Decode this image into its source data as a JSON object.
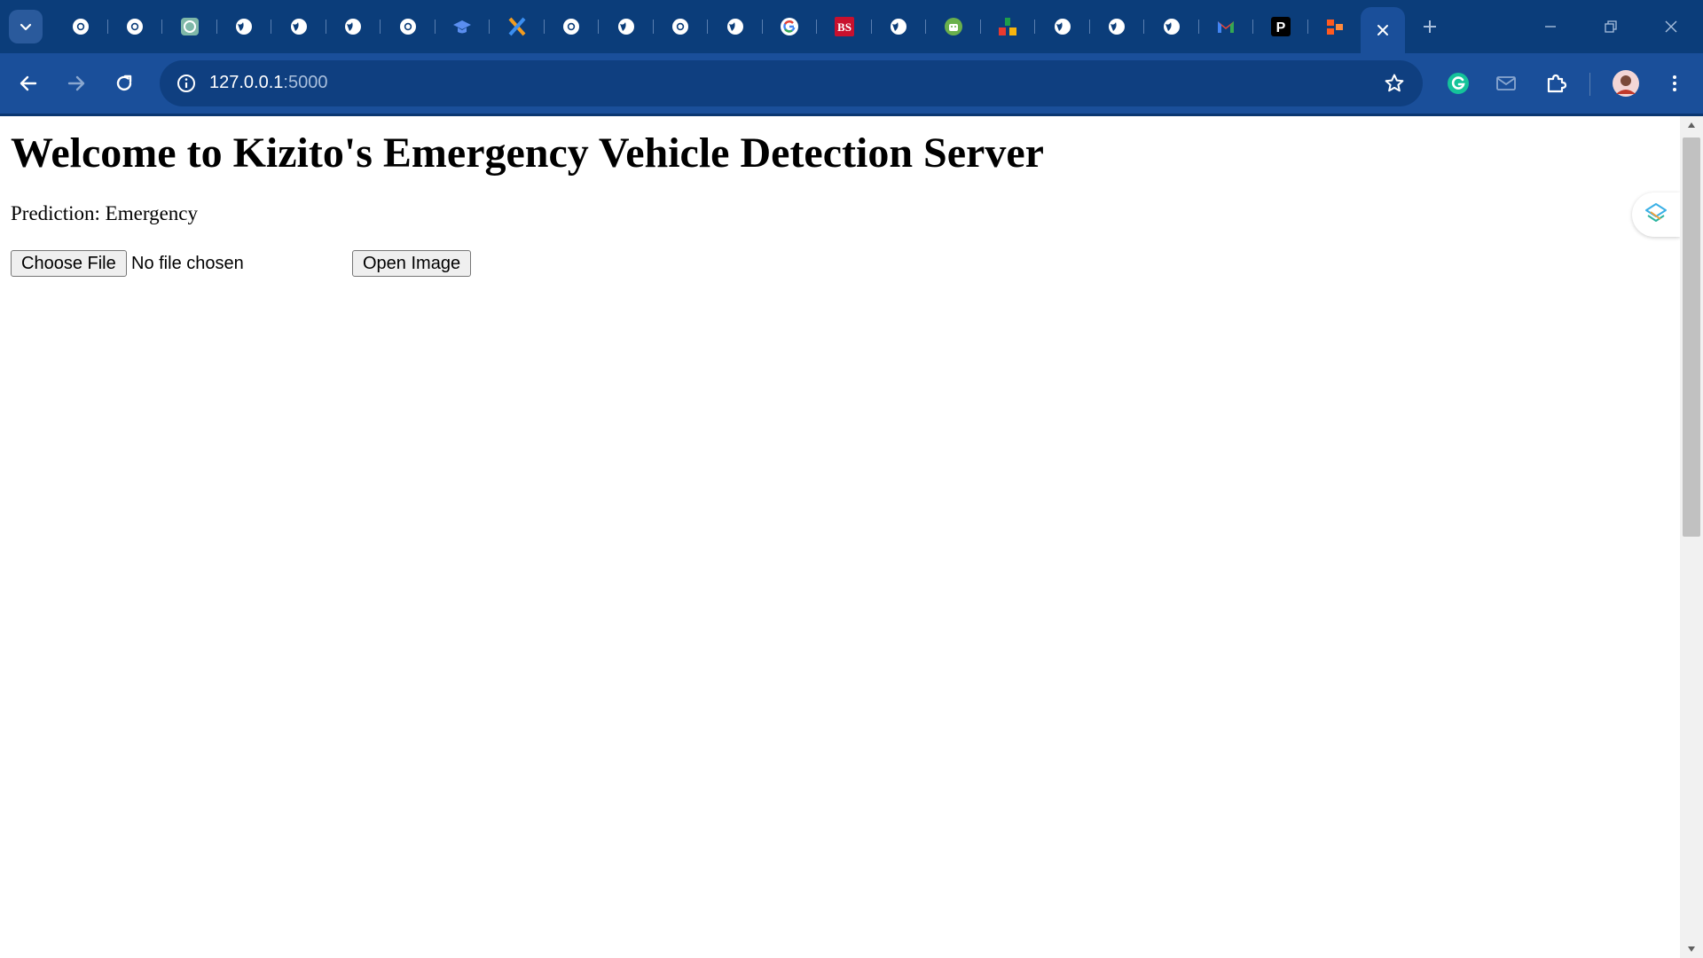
{
  "browser": {
    "tab_favicons": [
      "chrome-icon",
      "chrome-icon",
      "chatgpt-icon",
      "globe-icon",
      "globe-icon",
      "globe-icon",
      "chrome-icon",
      "graduation-cap-icon",
      "xcode-icon",
      "chrome-icon",
      "globe-icon",
      "chrome-icon",
      "globe-icon",
      "google-icon",
      "bs-icon",
      "globe-icon",
      "android-icon",
      "shapes-icon",
      "globe-icon",
      "globe-icon",
      "globe-icon",
      "gmail-icon",
      "p-icon",
      "orange-blocks-icon"
    ],
    "bs_label": "BS",
    "p_label": "P",
    "active_tab_icon": "close-icon",
    "url_host": "127.0.0.1",
    "url_port": ":5000",
    "colors": {
      "tab_strip": "#0b3d7a",
      "toolbar": "#1a4f9a",
      "omnibox": "#0f3f80"
    }
  },
  "page": {
    "title": "Welcome to Kizito's Emergency Vehicle Detection Server",
    "prediction": "Prediction: Emergency",
    "choose_file_label": "Choose File",
    "no_file_text": "No file chosen",
    "open_image_label": "Open Image"
  }
}
